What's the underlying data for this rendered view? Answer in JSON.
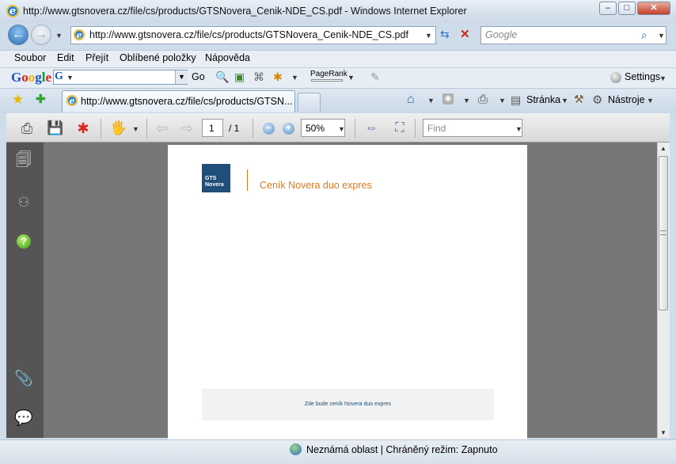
{
  "window": {
    "title": "http://www.gtsnovera.cz/file/cs/products/GTSNovera_Cenik-NDE_CS.pdf - Windows Internet Explorer",
    "ie_icon": "e"
  },
  "address": {
    "url": "http://www.gtsnovera.cz/file/cs/products/GTSNovera_Cenik-NDE_CS.pdf",
    "search_placeholder": "Google"
  },
  "menu": {
    "items": [
      "Soubor",
      "Edit",
      "Přejít",
      "Oblíbené položky",
      "Nápověda"
    ]
  },
  "google_toolbar": {
    "logo_letters": [
      "G",
      "o",
      "o",
      "g",
      "l",
      "e"
    ],
    "logo_colors": [
      "#1a52c7",
      "#d8261f",
      "#f4b400",
      "#1a52c7",
      "#109a3d",
      "#d8261f"
    ],
    "go_label": "Go",
    "pagerank_label": "PageRank",
    "settings_label": "Settings"
  },
  "tabs": {
    "active_tab_title": "http://www.gtsnovera.cz/file/cs/products/GTSN..."
  },
  "command_bar": {
    "page_label": "Stránka",
    "tools_label": "Nástroje"
  },
  "pdf_toolbar": {
    "page_current": "1",
    "page_total": "/ 1",
    "zoom": "50%",
    "find_placeholder": "Find"
  },
  "document": {
    "logo_line1": "GTS",
    "logo_line2": "Novera",
    "heading": "Ceník Novera duo expres",
    "placeholder_text": "Zde bude ceník Novera duo expres"
  },
  "status": {
    "zone": "Neznámá oblast | Chráněný režim: Zapnuto"
  },
  "colors": {
    "accent_orange": "#e07a1a",
    "logo_blue": "#1f4e79",
    "doc_bg": "#777777"
  }
}
